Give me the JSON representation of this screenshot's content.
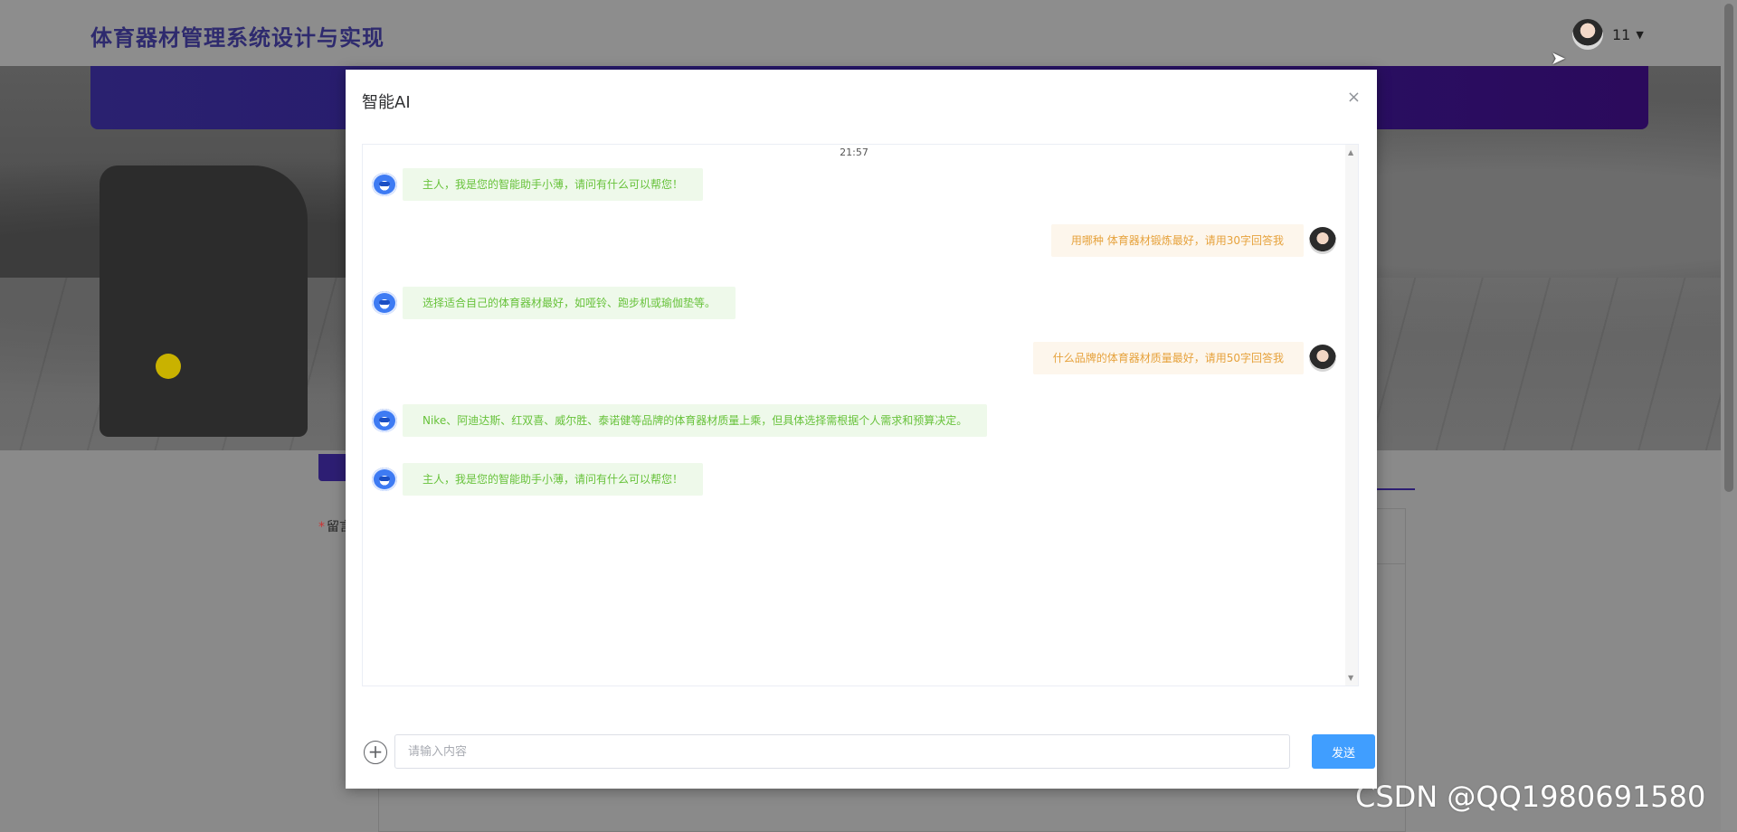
{
  "site": {
    "title": "体育器材管理系统设计与实现"
  },
  "user": {
    "name": "11"
  },
  "form": {
    "label_required": "*",
    "label_text": "留言"
  },
  "dialog": {
    "title": "智能AI",
    "close_label": "×",
    "timestamp": "21:57",
    "messages": [
      {
        "role": "bot",
        "text": "主人，我是您的智能助手小薄，请问有什么可以帮您！"
      },
      {
        "role": "user",
        "text": "用哪种 体育器材锻炼最好，请用30字回答我"
      },
      {
        "role": "bot",
        "text": "选择适合自己的体育器材最好，如哑铃、跑步机或瑜伽垫等。"
      },
      {
        "role": "user",
        "text": "什么品牌的体育器材质量最好，请用50字回答我"
      },
      {
        "role": "bot",
        "text": "Nike、阿迪达斯、红双喜、威尔胜、泰诺健等品牌的体育器材质量上乘，但具体选择需根据个人需求和预算决定。"
      },
      {
        "role": "bot",
        "text": "主人，我是您的智能助手小薄，请问有什么可以帮您！"
      }
    ],
    "input": {
      "placeholder": "请输入内容",
      "value": ""
    },
    "send_label": "发送"
  },
  "watermark": "CSDN @QQ1980691580",
  "colors": {
    "accent": "#409eff",
    "bot_text": "#67c23a",
    "bot_bg": "#eef9ea",
    "user_text": "#e6a23c",
    "user_bg": "#fdf6ec",
    "header_title": "#2e2a6e"
  },
  "icons": {
    "bot": "robot-icon",
    "user": "user-avatar",
    "add": "plus-circle-icon",
    "close": "close-icon",
    "caret": "caret-down-icon"
  }
}
